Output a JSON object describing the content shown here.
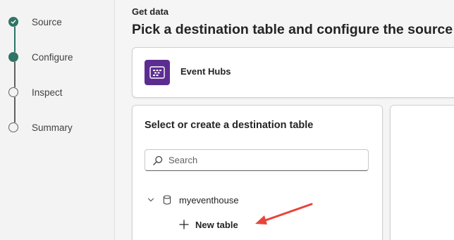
{
  "stepper": {
    "steps": [
      {
        "label": "Source",
        "state": "done"
      },
      {
        "label": "Configure",
        "state": "current"
      },
      {
        "label": "Inspect",
        "state": "pending"
      },
      {
        "label": "Summary",
        "state": "pending"
      }
    ],
    "accent_color": "#2f7466"
  },
  "header": {
    "eyebrow": "Get data",
    "title": "Pick a destination table and configure the source"
  },
  "source": {
    "name": "Event Hubs",
    "icon": "event-hubs-icon",
    "icon_color": "#5c2d91"
  },
  "destination": {
    "title": "Select or create a destination table",
    "search": {
      "placeholder": "Search",
      "value": ""
    },
    "tree": {
      "database": {
        "label": "myeventhouse",
        "expanded": true,
        "icon": "database-icon"
      },
      "new_table": {
        "label": "New table",
        "icon": "plus-icon"
      }
    }
  },
  "annotation": {
    "arrow_color": "#e8443a"
  }
}
